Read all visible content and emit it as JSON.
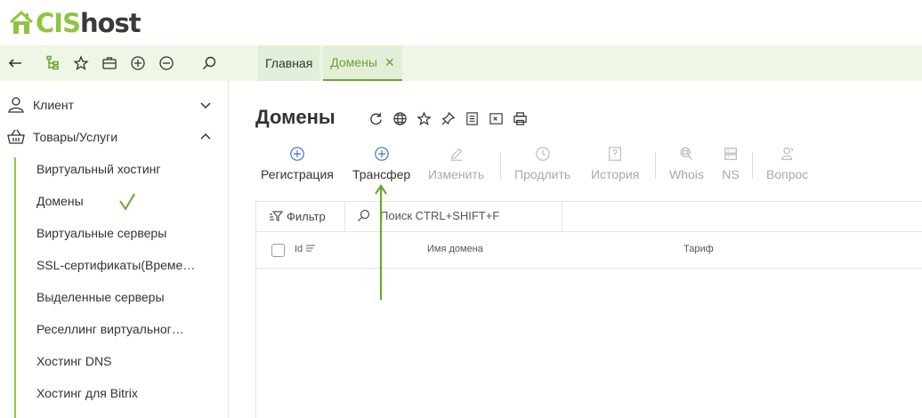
{
  "brand": {
    "cis": "CIS",
    "host": "host",
    "accent": "#8cc63f"
  },
  "toolbar": {
    "icons": [
      "back-arrow-icon",
      "tree-icon",
      "star-icon",
      "briefcase-icon",
      "plus-circle-icon",
      "minus-circle-icon",
      "search-icon"
    ]
  },
  "tabs": [
    {
      "label": "Главная",
      "active": false
    },
    {
      "label": "Домены",
      "active": true,
      "close": "✕"
    }
  ],
  "sidebar": {
    "client": "Клиент",
    "goods": "Товары/Услуги",
    "items": [
      "Виртуальный хостинг",
      "Домены",
      "Виртуальные серверы",
      "SSL-сертификаты(Време…",
      "Выделенные серверы",
      "Реселлинг виртуальног…",
      "Хостинг DNS",
      "Хостинг для Bitrix"
    ],
    "selected_index": 1
  },
  "page": {
    "title": "Домены",
    "title_icons": [
      "refresh-icon",
      "globe-icon",
      "star-icon",
      "pin-icon",
      "document-icon",
      "excel-icon",
      "print-icon"
    ]
  },
  "actions": [
    {
      "label": "Регистрация",
      "icon": "plus-circle-icon",
      "enabled": true
    },
    {
      "label": "Трансфер",
      "icon": "plus-circle-icon",
      "enabled": true
    },
    {
      "label": "Изменить",
      "icon": "pencil-icon",
      "enabled": false
    },
    {
      "label": "Продлить",
      "icon": "clock-icon",
      "enabled": false
    },
    {
      "label": "История",
      "icon": "question-doc-icon",
      "enabled": false
    },
    {
      "label": "Whois",
      "icon": "magnifier-icon",
      "enabled": false
    },
    {
      "label": "NS",
      "icon": "server-icon",
      "enabled": false
    },
    {
      "label": "Вопрос",
      "icon": "user-question-icon",
      "enabled": false
    }
  ],
  "grid": {
    "filter_label": "Фильтр",
    "search_placeholder": "Поиск CTRL+SHIFT+F",
    "columns": [
      "Id",
      "Имя домена",
      "Тариф"
    ]
  }
}
